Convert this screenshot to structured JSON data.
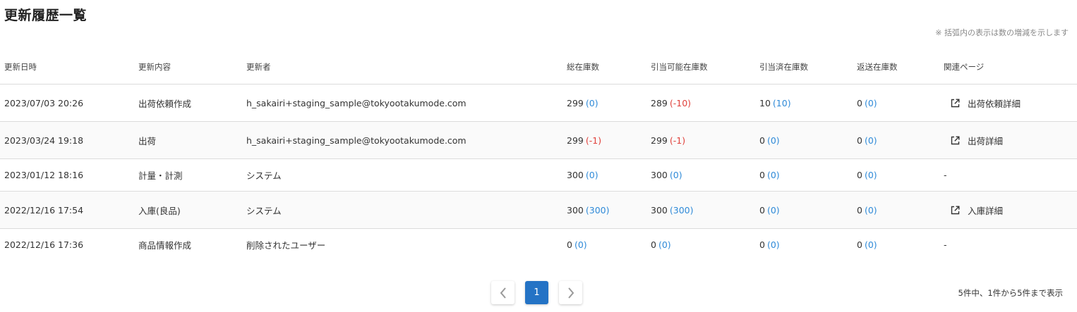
{
  "page": {
    "title": "更新履歴一覧",
    "note": "※ 括弧内の表示は数の増減を示します"
  },
  "table": {
    "headers": [
      "更新日時",
      "更新内容",
      "更新者",
      "総在庫数",
      "引当可能在庫数",
      "引当済在庫数",
      "返送在庫数",
      "関連ページ"
    ],
    "rows": [
      {
        "date": "2023/07/03 20:26",
        "content": "出荷依頼作成",
        "user": "h_sakairi+staging_sample@tokyootakumode.com",
        "total": "299",
        "total_delta": "(0)",
        "total_sign": "pos",
        "available": "289",
        "available_delta": "(-10)",
        "available_sign": "neg",
        "allocated": "10",
        "allocated_delta": "(10)",
        "allocated_sign": "pos",
        "returned": "0",
        "returned_delta": "(0)",
        "returned_sign": "pos",
        "link": "出荷依頼詳細",
        "link_icon": "external-link-icon"
      },
      {
        "date": "2023/03/24 19:18",
        "content": "出荷",
        "user": "h_sakairi+staging_sample@tokyootakumode.com",
        "total": "299",
        "total_delta": "(-1)",
        "total_sign": "neg",
        "available": "299",
        "available_delta": "(-1)",
        "available_sign": "neg",
        "allocated": "0",
        "allocated_delta": "(0)",
        "allocated_sign": "pos",
        "returned": "0",
        "returned_delta": "(0)",
        "returned_sign": "pos",
        "link": "出荷詳細",
        "link_icon": "external-link-icon"
      },
      {
        "date": "2023/01/12 18:16",
        "content": "計量・計測",
        "user": "システム",
        "total": "300",
        "total_delta": "(0)",
        "total_sign": "pos",
        "available": "300",
        "available_delta": "(0)",
        "available_sign": "pos",
        "allocated": "0",
        "allocated_delta": "(0)",
        "allocated_sign": "pos",
        "returned": "0",
        "returned_delta": "(0)",
        "returned_sign": "pos",
        "link_none": "-"
      },
      {
        "date": "2022/12/16 17:54",
        "content": "入庫(良品)",
        "user": "システム",
        "total": "300",
        "total_delta": "(300)",
        "total_sign": "pos",
        "available": "300",
        "available_delta": "(300)",
        "available_sign": "pos",
        "allocated": "0",
        "allocated_delta": "(0)",
        "allocated_sign": "pos",
        "returned": "0",
        "returned_delta": "(0)",
        "returned_sign": "pos",
        "link": "入庫詳細",
        "link_icon": "external-link-icon"
      },
      {
        "date": "2022/12/16 17:36",
        "content": "商品情報作成",
        "user": "削除されたユーザー",
        "total": "0",
        "total_delta": "(0)",
        "total_sign": "pos",
        "available": "0",
        "available_delta": "(0)",
        "available_sign": "pos",
        "allocated": "0",
        "allocated_delta": "(0)",
        "allocated_sign": "pos",
        "returned": "0",
        "returned_delta": "(0)",
        "returned_sign": "pos",
        "link_none": "-"
      }
    ]
  },
  "pagination": {
    "prev_icon": "chevron-left-icon",
    "next_icon": "chevron-right-icon",
    "current_page": "1",
    "summary": "5件中、1件から5件まで表示"
  },
  "colors": {
    "accent": "#2473c5",
    "positive_delta": "#2f8ad8",
    "negative_delta": "#e0413b"
  }
}
